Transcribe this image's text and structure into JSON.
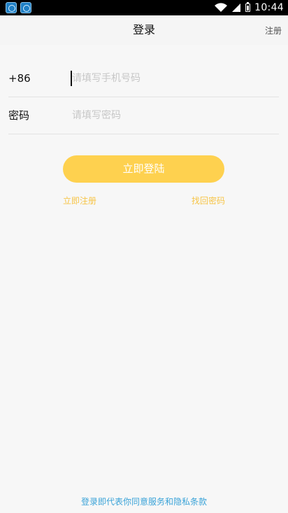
{
  "status_bar": {
    "time": "10:44",
    "icons": [
      "app-icon",
      "app-icon",
      "wifi-icon",
      "signal-icon",
      "battery-icon"
    ]
  },
  "nav": {
    "title": "登录",
    "register": "注册"
  },
  "form": {
    "phone": {
      "country_code": "+86",
      "placeholder": "请填写手机号码",
      "value": ""
    },
    "password": {
      "label": "密码",
      "placeholder": "请填写密码",
      "value": ""
    }
  },
  "actions": {
    "login": "立即登陆",
    "register": "立即注册",
    "forgot_password": "找回密码"
  },
  "footer": {
    "agreement": "登录即代表你同意服务和隐私条款"
  },
  "colors": {
    "accent": "#fed14f",
    "link": "#f7c548",
    "agreement_link": "#3aa3d8"
  }
}
